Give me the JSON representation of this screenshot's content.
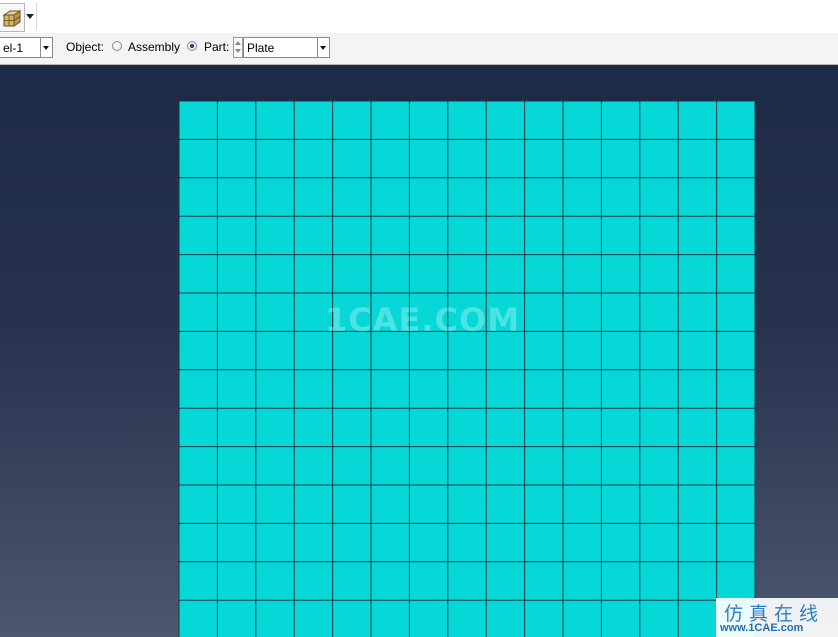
{
  "toolbar": {
    "part_icon": "part-cube-icon",
    "dropdown_icon": "chevron-down-icon"
  },
  "context_bar": {
    "model_value": "el-1",
    "object_label": "Object:",
    "assembly_label": "Assembly",
    "part_label": "Part:",
    "part_value": "Plate",
    "selected_object": "Part"
  },
  "viewport": {
    "mesh_rows": 14,
    "mesh_cols": 15,
    "mesh_fill": "#06d8d8",
    "mesh_edge": "#0f3f46",
    "background_top": "#1d2a47",
    "background_bottom": "#4c5770"
  },
  "watermark": {
    "text": "1CAE.COM"
  },
  "logo": {
    "chinese": "仿真在线",
    "url": "www.1CAE.com"
  }
}
